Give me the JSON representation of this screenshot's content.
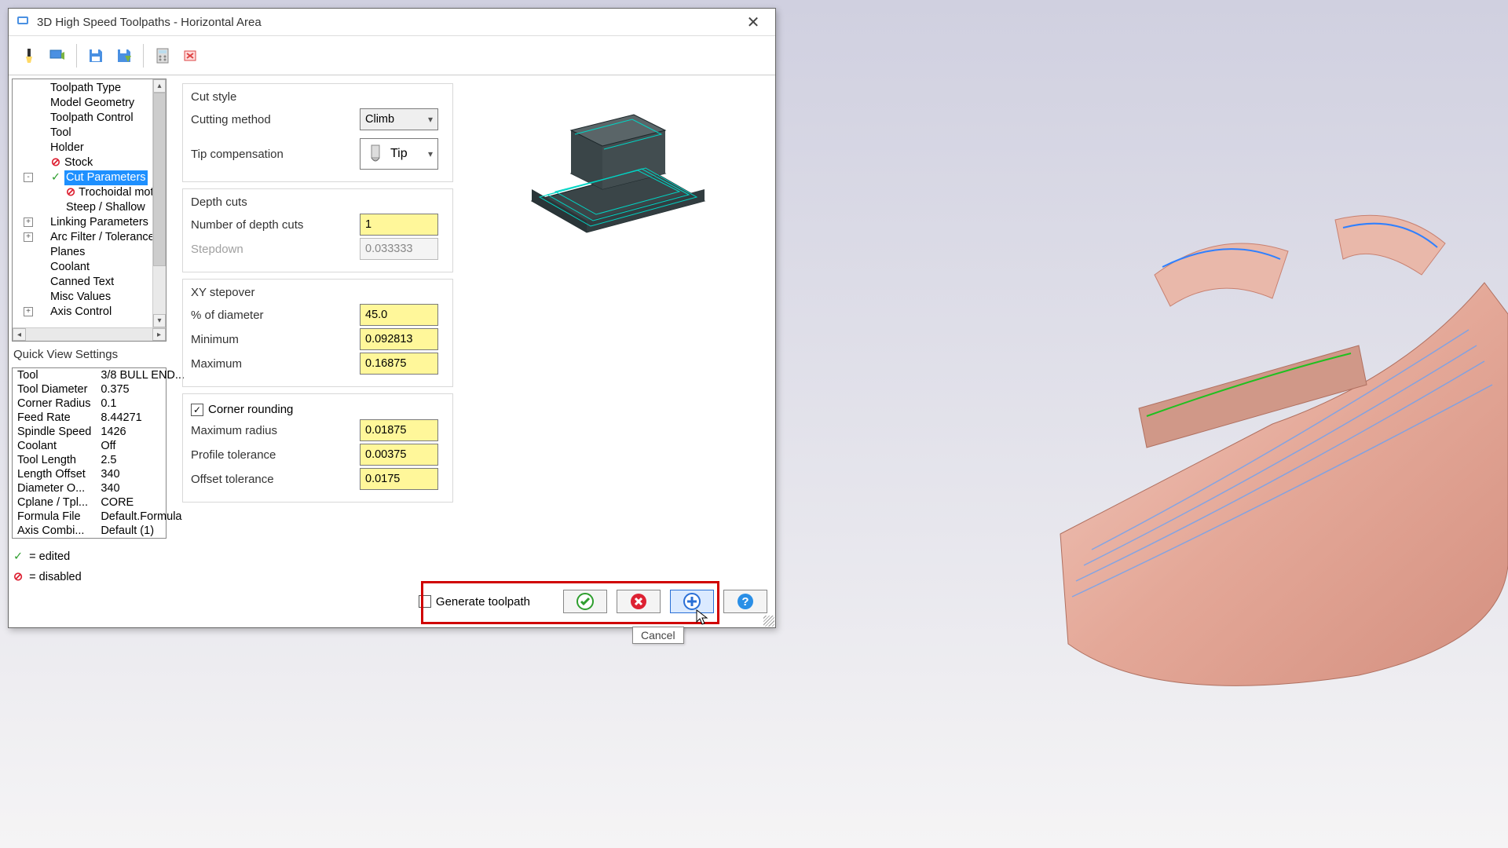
{
  "window": {
    "title": "3D High Speed Toolpaths - Horizontal Area"
  },
  "tree": {
    "items": [
      {
        "label": "Toolpath Type",
        "indent": 1
      },
      {
        "label": "Model Geometry",
        "indent": 1
      },
      {
        "label": "Toolpath Control",
        "indent": 1
      },
      {
        "label": "Tool",
        "indent": 1
      },
      {
        "label": "Holder",
        "indent": 1
      },
      {
        "label": "Stock",
        "indent": 1,
        "status": "disabled"
      },
      {
        "label": "Cut Parameters",
        "indent": 1,
        "status": "edited",
        "selected": true,
        "expander": "-"
      },
      {
        "label": "Trochoidal motion",
        "indent": 2,
        "status": "disabled"
      },
      {
        "label": "Steep / Shallow",
        "indent": 2
      },
      {
        "label": "Linking Parameters",
        "indent": 1,
        "expander": "+"
      },
      {
        "label": "Arc Filter / Tolerance",
        "indent": 1,
        "expander": "+"
      },
      {
        "label": "Planes",
        "indent": 1
      },
      {
        "label": "Coolant",
        "indent": 1
      },
      {
        "label": "Canned Text",
        "indent": 1
      },
      {
        "label": "Misc Values",
        "indent": 1
      },
      {
        "label": "Axis Control",
        "indent": 1,
        "expander": "+"
      }
    ]
  },
  "quick_view": {
    "title": "Quick View Settings",
    "rows": [
      {
        "k": "Tool",
        "v": "3/8 BULL END..."
      },
      {
        "k": "Tool Diameter",
        "v": "0.375"
      },
      {
        "k": "Corner Radius",
        "v": "0.1"
      },
      {
        "k": "Feed Rate",
        "v": "8.44271"
      },
      {
        "k": "Spindle Speed",
        "v": "1426"
      },
      {
        "k": "Coolant",
        "v": "Off"
      },
      {
        "k": "Tool Length",
        "v": "2.5"
      },
      {
        "k": "Length Offset",
        "v": "340"
      },
      {
        "k": "Diameter O...",
        "v": "340"
      },
      {
        "k": "Cplane / Tpl...",
        "v": "CORE"
      },
      {
        "k": "Formula File",
        "v": "Default.Formula"
      },
      {
        "k": "Axis Combi...",
        "v": "Default (1)"
      }
    ]
  },
  "legend": {
    "edited": "= edited",
    "disabled": "= disabled"
  },
  "params": {
    "cut_style": {
      "title": "Cut style",
      "cutting_method_label": "Cutting method",
      "cutting_method_value": "Climb",
      "tip_comp_label": "Tip compensation",
      "tip_comp_value": "Tip"
    },
    "depth": {
      "title": "Depth cuts",
      "num_label": "Number of depth cuts",
      "num_value": "1",
      "stepdown_label": "Stepdown",
      "stepdown_value": "0.033333"
    },
    "xy": {
      "title": "XY stepover",
      "pct_label": "% of diameter",
      "pct_value": "45.0",
      "min_label": "Minimum",
      "min_value": "0.092813",
      "max_label": "Maximum",
      "max_value": "0.16875"
    },
    "corner": {
      "checkbox_label": "Corner rounding",
      "radius_label": "Maximum radius",
      "radius_value": "0.01875",
      "profile_label": "Profile tolerance",
      "profile_value": "0.00375",
      "offset_label": "Offset tolerance",
      "offset_value": "0.0175"
    }
  },
  "footer": {
    "generate_label": "Generate toolpath",
    "tooltip": "Cancel"
  }
}
